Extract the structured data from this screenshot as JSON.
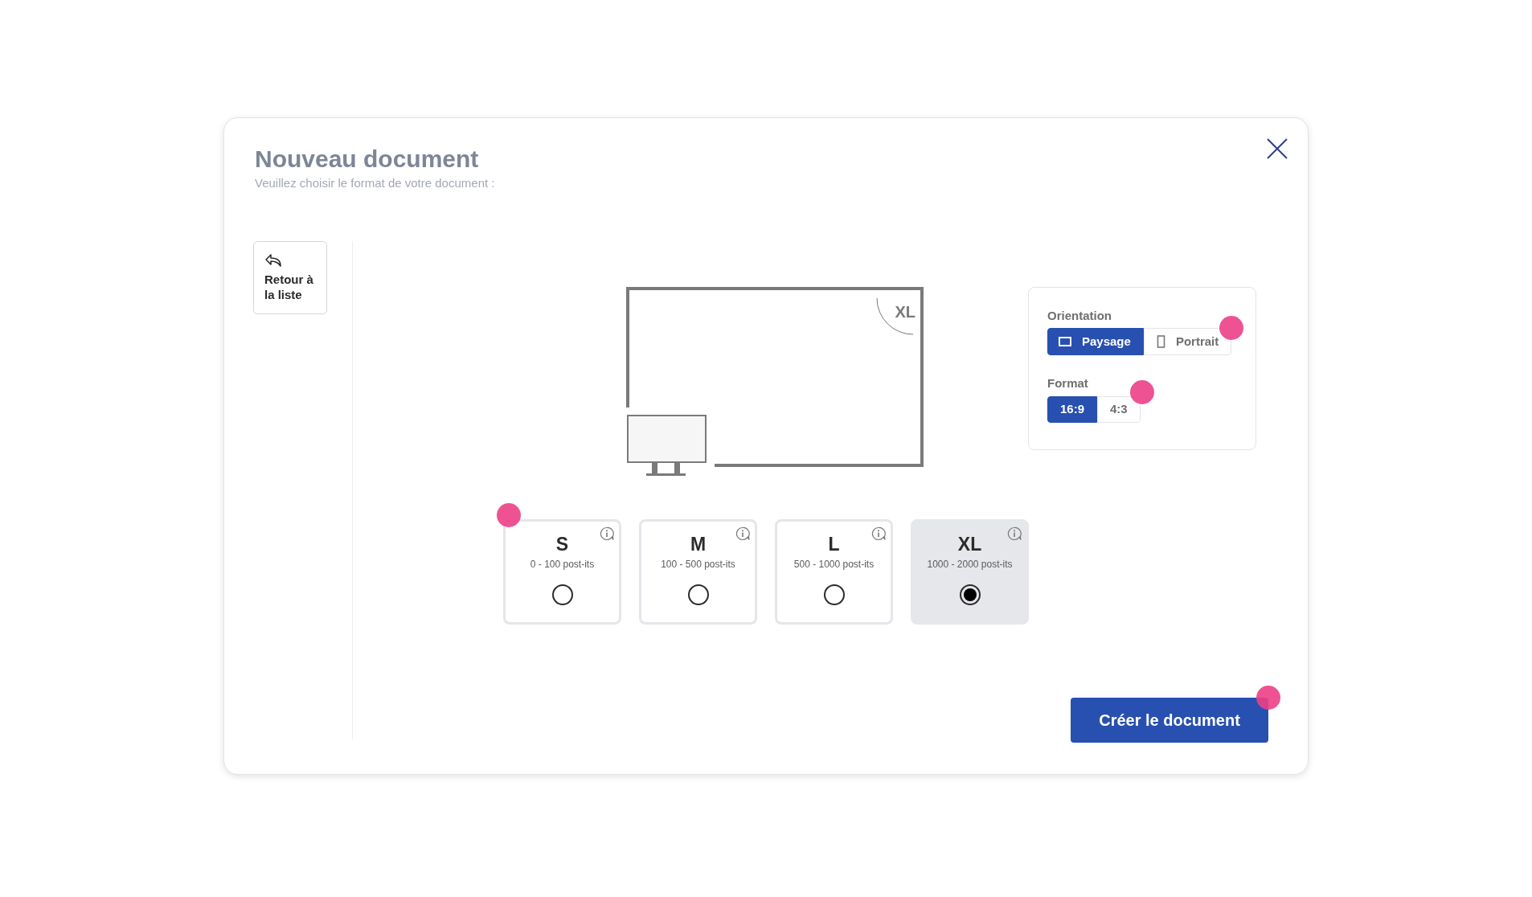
{
  "dialog": {
    "title": "Nouveau document",
    "subtitle": "Veuillez choisir le format de votre document :"
  },
  "back_button": {
    "label": "Retour à la liste"
  },
  "preview": {
    "label": "XL"
  },
  "orientation": {
    "label": "Orientation",
    "hotspot": true,
    "options": [
      {
        "label": "Paysage",
        "kind": "landscape",
        "selected": true
      },
      {
        "label": "Portrait",
        "kind": "portrait",
        "selected": false
      }
    ]
  },
  "format": {
    "label": "Format",
    "hotspot": true,
    "options": [
      {
        "label": "16:9",
        "selected": true
      },
      {
        "label": "4:3",
        "selected": false
      }
    ]
  },
  "sizes": [
    {
      "name": "S",
      "range": "0 - 100 post-its",
      "selected": false,
      "hotspot": true
    },
    {
      "name": "M",
      "range": "100 - 500 post-its",
      "selected": false,
      "hotspot": false
    },
    {
      "name": "L",
      "range": "500 - 1000 post-its",
      "selected": false,
      "hotspot": false
    },
    {
      "name": "XL",
      "range": "1000 - 2000 post-its",
      "selected": true,
      "hotspot": false
    }
  ],
  "create_button": {
    "label": "Créer le document",
    "hotspot": true
  }
}
